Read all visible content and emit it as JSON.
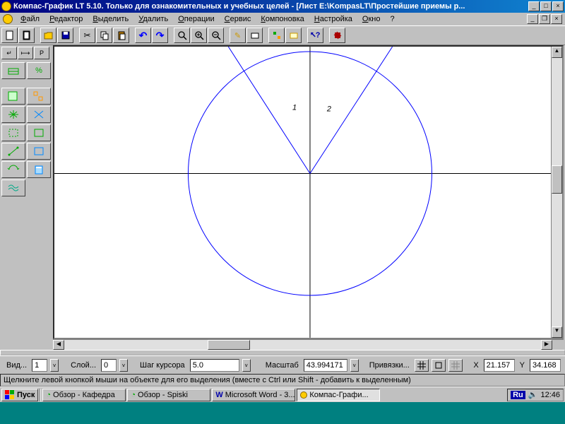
{
  "titlebar": {
    "title": "Компас-График LT 5.10. Только для ознакомительных и учебных целей - [Лист E:\\KompasLT\\Простейшие приемы р..."
  },
  "menu": {
    "file": "Файл",
    "editor": "Редактор",
    "select": "Выделить",
    "delete": "Удалить",
    "operations": "Операции",
    "service": "Сервис",
    "layout": "Компоновка",
    "settings": "Настройка",
    "window": "Окно",
    "help": "?"
  },
  "left_tabs": {
    "t1": "↵",
    "t2": "⟼",
    "t3": "P"
  },
  "params": {
    "view_label": "Вид...",
    "view_value": "1",
    "layer_label": "Слой...",
    "layer_value": "0",
    "step_label": "Шаг курсора",
    "step_value": "5.0",
    "scale_label": "Масштаб",
    "scale_value": "43.994171",
    "snap_label": "Привязки...",
    "x_label": "X",
    "x_value": "21.157",
    "y_label": "Y",
    "y_value": "34.168"
  },
  "status": {
    "text": "Щелкните левой кнопкой мыши на объекте для его выделения (вместе с Ctrl или Shift - добавить к выделенным)"
  },
  "taskbar": {
    "start": "Пуск",
    "t1": "Обзор - Кафедра",
    "t2": "Обзор - Spiski",
    "t3": "Microsoft Word - 3...",
    "t4": "Компас-Графи...",
    "lang": "Ru",
    "time": "12:46"
  },
  "canvas": {
    "num1": "1",
    "num2": "2"
  }
}
